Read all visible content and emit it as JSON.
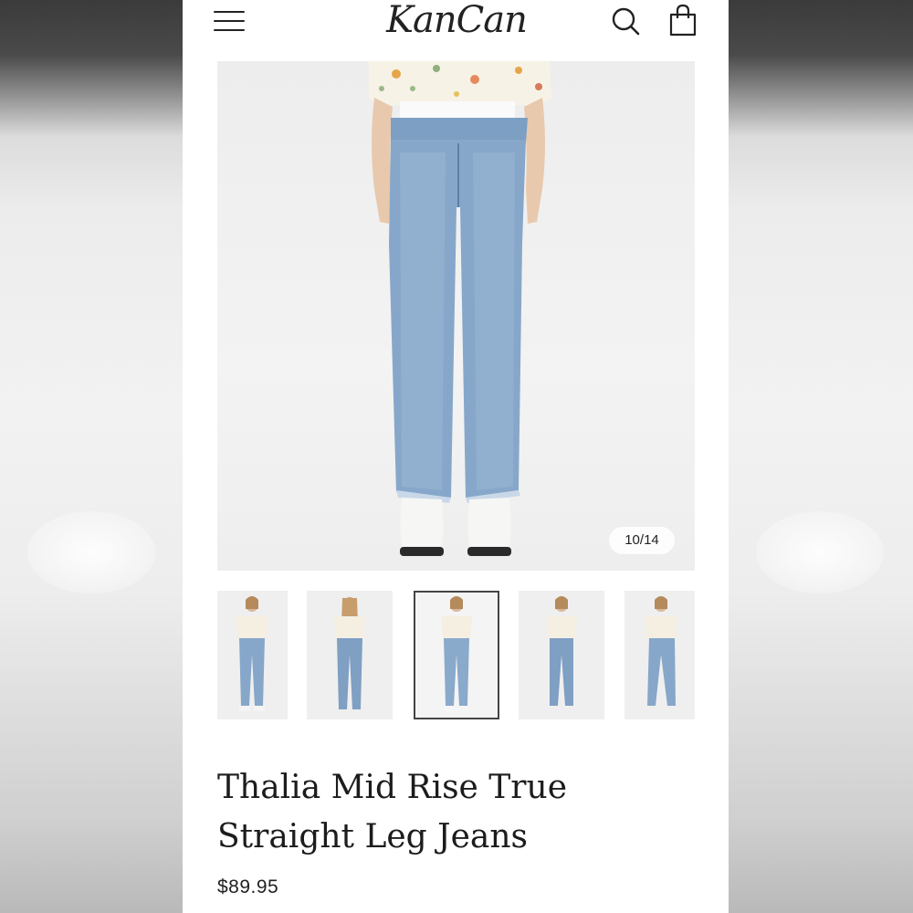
{
  "header": {
    "logo_text": "KanCan",
    "menu_icon": "hamburger-menu-icon",
    "search_icon": "search-icon",
    "bag_icon": "shopping-bag-icon"
  },
  "gallery": {
    "counter": "10/14",
    "active_thumbnail": 3,
    "thumbnail_count": 5
  },
  "product": {
    "title_line1": "Thalia Mid Rise True",
    "title_line2": "Straight Leg Jeans",
    "price": "$89.95"
  },
  "colors": {
    "denim": "#7ea0c4",
    "text": "#1c1c1c",
    "background": "#ffffff"
  }
}
